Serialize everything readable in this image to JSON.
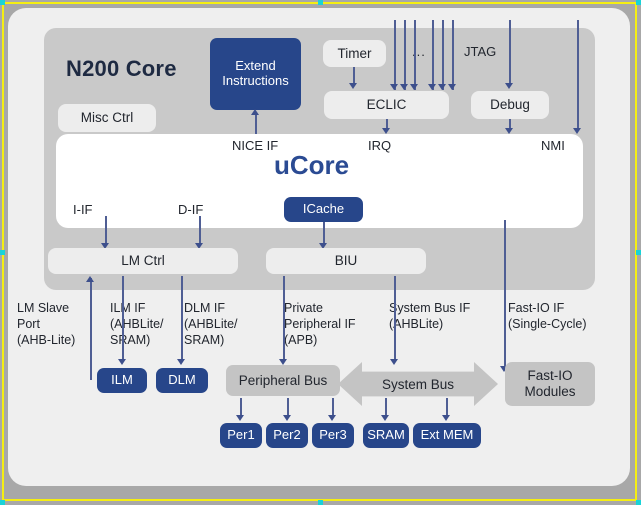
{
  "diagram": {
    "title": "N200 Core",
    "ucore_label": "uCore",
    "core_blocks": {
      "misc_ctrl": "Misc Ctrl",
      "extend_instructions": "Extend\nInstructions",
      "timer": "Timer",
      "ellipsis": "...",
      "jtag": "JTAG",
      "eclic": "ECLIC",
      "debug": "Debug",
      "icache": "ICache",
      "lm_ctrl": "LM Ctrl",
      "biu": "BIU"
    },
    "signal_labels": {
      "nice_if": "NICE IF",
      "irq": "IRQ",
      "nmi": "NMI",
      "i_if": "I-IF",
      "d_if": "D-IF"
    },
    "interface_labels": [
      "LM Slave\nPort\n(AHB-Lite)",
      "ILM IF\n(AHBLite/\nSRAM)",
      "DLM IF\n(AHBLite/\nSRAM)",
      "Private\nPeripheral IF\n(APB)",
      "System Bus IF\n(AHBLite)",
      "Fast-IO IF\n(Single-Cycle)"
    ],
    "memories": {
      "ilm": "ILM",
      "dlm": "DLM"
    },
    "buses": {
      "peripheral_bus": "Peripheral Bus",
      "system_bus": "System Bus",
      "fast_io_modules": "Fast-IO\nModules"
    },
    "peripherals": [
      "Per1",
      "Per2",
      "Per3"
    ],
    "memory_devices": [
      "SRAM",
      "Ext MEM"
    ],
    "colors": {
      "accent_blue": "#27468a",
      "ucore_text": "#2b4b93",
      "core_panel": "#c9c9c9",
      "card_bg": "#efefef",
      "line": "#4f5e94",
      "selection": "#f5ee12",
      "handle": "#19d3d8"
    }
  }
}
